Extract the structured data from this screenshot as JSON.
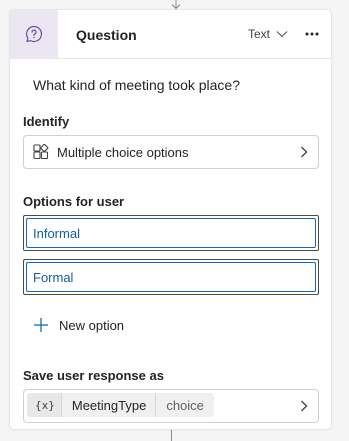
{
  "node": {
    "title": "Question",
    "icon": "question-bubble-icon",
    "type_selector": {
      "value": "Text",
      "icon": "chevron-down-icon"
    },
    "more_icon": "more-horizontal-icon",
    "prompt": "What kind of meeting took place?"
  },
  "identify": {
    "label": "Identify",
    "value": "Multiple choice options",
    "icon": "multiple-choice-icon"
  },
  "options": {
    "label": "Options for user",
    "items": [
      "Informal",
      "Formal"
    ],
    "add_label": "New option",
    "add_icon": "plus-icon"
  },
  "save_response": {
    "label": "Save user response as",
    "variable_icon": "{x}",
    "variable_name": "MeetingType",
    "variable_type": "choice"
  },
  "colors": {
    "accent": "#0f6cbd",
    "icon_tile_bg": "#ece6f3",
    "icon_purple": "#6b4ea0"
  }
}
